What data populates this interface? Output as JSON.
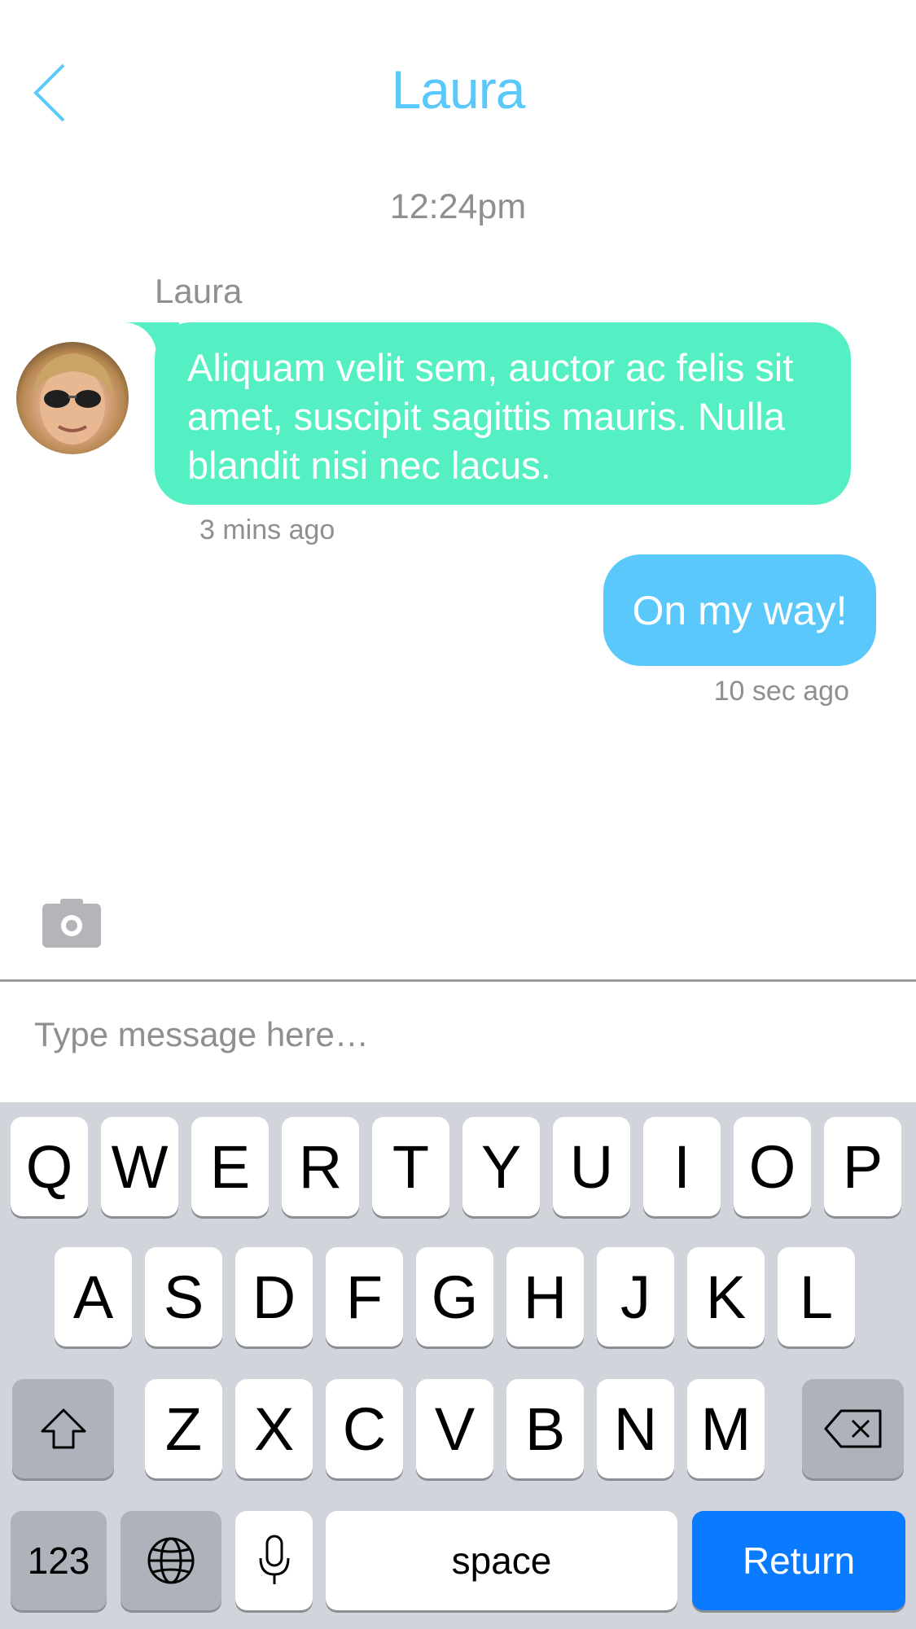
{
  "header": {
    "title": "Laura",
    "back_icon": "chevron-left-icon"
  },
  "thread": {
    "timestamp": "12:24pm",
    "incoming": {
      "sender": "Laura",
      "text": "Aliquam velit sem, auctor ac felis sit amet, suscipit sagittis mauris. Nulla blandit nisi nec lacus.",
      "time": "3 mins ago"
    },
    "outgoing": {
      "text": "On my way!",
      "time": "10 sec ago"
    }
  },
  "composer": {
    "placeholder": "Type message here…",
    "camera_icon": "camera-icon"
  },
  "keyboard": {
    "row1": [
      "Q",
      "W",
      "E",
      "R",
      "T",
      "Y",
      "U",
      "I",
      "O",
      "P"
    ],
    "row2": [
      "A",
      "S",
      "D",
      "F",
      "G",
      "H",
      "J",
      "K",
      "L"
    ],
    "row3": [
      "Z",
      "X",
      "C",
      "V",
      "B",
      "N",
      "M"
    ],
    "numbers": "123",
    "space": "space",
    "return": "Return"
  },
  "colors": {
    "accent": "#5ac8fa",
    "incoming_bubble": "#55efc4",
    "outgoing_bubble": "#5ac8fa",
    "return_key": "#0a7bff",
    "keyboard_bg": "#d1d5db"
  }
}
